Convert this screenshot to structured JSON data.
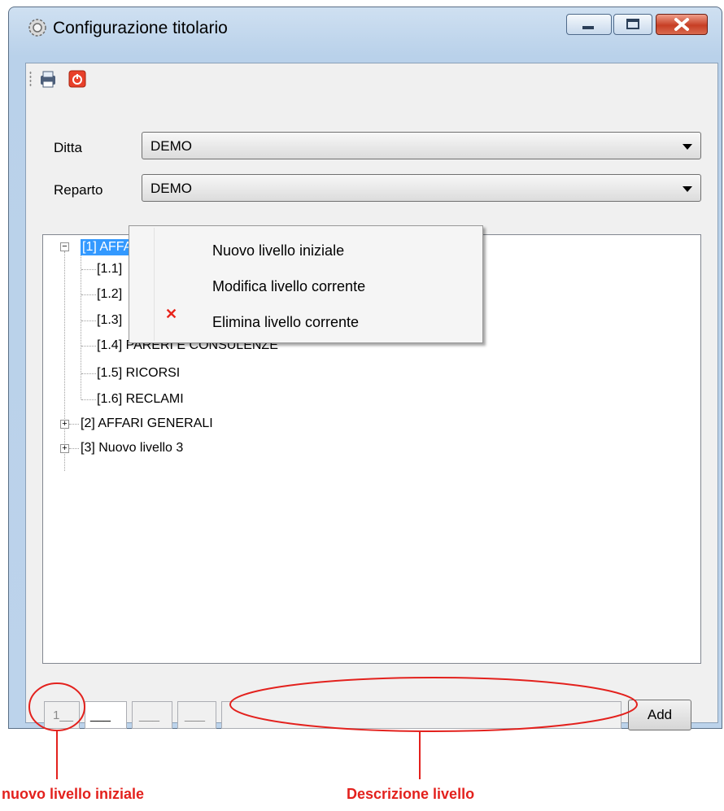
{
  "window": {
    "title": "Configurazione titolario",
    "icons": {
      "title": "gear-icon",
      "minimize": "minimize-icon",
      "maximize": "maximize-icon",
      "close": "close-icon"
    }
  },
  "toolbar": {
    "print_icon": "print-icon",
    "power_icon": "power-icon"
  },
  "form": {
    "ditta_label": "Ditta",
    "ditta_value": "DEMO",
    "reparto_label": "Reparto",
    "reparto_value": "DEMO"
  },
  "tree": {
    "root1": "[1] AFFA",
    "children": [
      "[1.1]",
      "[1.2]",
      "[1.3]",
      "[1.4] PARERI E CONSULENZE",
      "[1.5] RICORSI",
      "[1.6] RECLAMI"
    ],
    "root2": "[2] AFFARI GENERALI",
    "root3": "[3] Nuovo livello 3"
  },
  "context_menu": {
    "items": [
      "Nuovo livello iniziale",
      "Modifica livello corrente",
      "Elimina livello corrente"
    ],
    "delete_icon": "delete-icon"
  },
  "bottom": {
    "level1_value": "1__",
    "level2_value": "___",
    "level3_value": "___",
    "level4_value": "___",
    "description_value": "",
    "add_label": "Add"
  },
  "annotations": {
    "left": "nuovo livello iniziale",
    "right": "Descrizione livello",
    "color": "#e3211d"
  }
}
